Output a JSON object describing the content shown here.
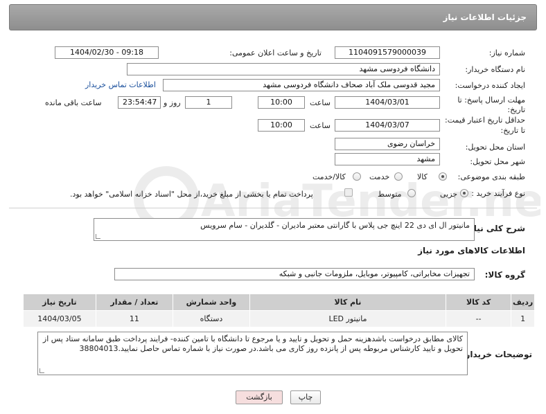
{
  "header": {
    "title": "جزئیات اطلاعات نیاز"
  },
  "form": {
    "need_number": {
      "label": "شماره نیاز:",
      "value": "1104091579000039"
    },
    "announce": {
      "label": "تاریخ و ساعت اعلان عمومی:",
      "value": "1404/02/30 - 09:18"
    },
    "buyer_org": {
      "label": "نام دستگاه خریدار:",
      "value": "دانشگاه فردوسی مشهد"
    },
    "requester": {
      "label": "ایجاد کننده درخواست:",
      "value": "مجید قدوسی ملک آباد صحاف دانشگاه فردوسی مشهد",
      "contact_link": "اطلاعات تماس خریدار"
    },
    "reply_deadline": {
      "label_line1": "مهلت ارسال پاسخ: تا",
      "label_line2": "تاریخ:",
      "date": "1404/03/01",
      "time_label": "ساعت",
      "time": "10:00",
      "days": "1",
      "days_label": "روز و",
      "remaining": "23:54:47",
      "remaining_label": "ساعت باقی مانده"
    },
    "price_validity": {
      "label_line1": "حداقل تاریخ اعتبار قیمت:",
      "label_line2": "تا تاریخ:",
      "date": "1404/03/07",
      "time_label": "ساعت",
      "time": "10:00"
    },
    "province": {
      "label": "استان محل تحویل:",
      "value": "خراسان رضوی"
    },
    "city": {
      "label": "شهر محل تحویل:",
      "value": "مشهد"
    },
    "category": {
      "label": "طبقه بندی موضوعی:",
      "options": [
        "کالا",
        "خدمت",
        "کالا/خدمت"
      ],
      "selected": "کالا"
    },
    "process": {
      "label": "نوع فرآیند خرید :",
      "options": [
        "جزیی",
        "متوسط"
      ],
      "selected": "جزیی",
      "payment_note": "پرداخت تمام یا بخشی از مبلغ خرید،از محل \"اسناد خزانه اسلامی\" خواهد بود."
    }
  },
  "description": {
    "label": "شرح کلی نیاز:",
    "value": "مانیتور ال ای دی  22 اینچ جی پلاس با گارانتی  معتبر مادیران - گلدیران - سام سرویس"
  },
  "goods_section": {
    "title": "اطلاعات کالاهای مورد نیاز"
  },
  "goods_group": {
    "label": "گروه کالا:",
    "value": "تجهیزات مخابراتی، کامپیوتر، موبایل، ملزومات جانبی و شبکه"
  },
  "table": {
    "headers": [
      "ردیف",
      "کد کالا",
      "نام کالا",
      "واحد شمارش",
      "تعداد / مقدار",
      "تاریخ نیاز"
    ],
    "rows": [
      [
        "1",
        "--",
        "مانیتور LED",
        "دستگاه",
        "11",
        "1404/03/05"
      ]
    ]
  },
  "buyer_notes": {
    "label": "توضیحات خریدار:",
    "value": "کالای مطابق درخواست باشدهزینه حمل و تحویل و تایید و یا مرجوع تا دانشگاه با تامین کننده- فرایند پرداخت طبق سامانه ستاد پس از تحویل و تایید کارشناس مربوطه پس از پانزده روز کاری می باشد.در صورت نیاز با شماره تماس حاصل نمایید.38804013"
  },
  "buttons": {
    "print": "چاپ",
    "back": "بازگشت"
  },
  "watermark": {
    "text": "AriaTender.net"
  },
  "colors": {
    "link": "#1a4f9c",
    "header_bg": "#9b9b9b",
    "back_button": "#f6dede",
    "watermark": "#e8e8e8"
  }
}
